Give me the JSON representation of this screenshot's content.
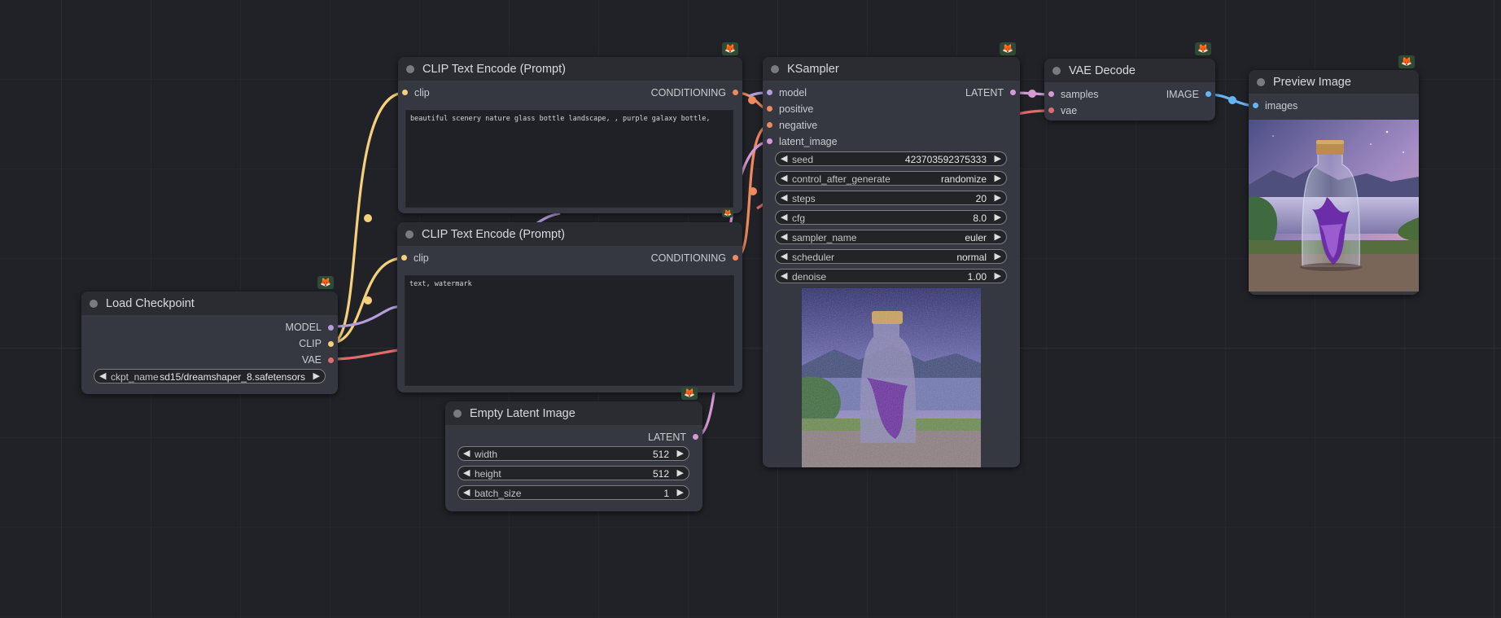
{
  "colors": {
    "model": "#b39ddb",
    "clip": "#f6d07a",
    "vae": "#e06c6c",
    "conditioning": "#f08a5d",
    "latent": "#d59ad6",
    "image": "#64b5f6"
  },
  "badge_icon": "fox-icon",
  "badge_glyph": "🦊",
  "nodes": {
    "load_checkpoint": {
      "title": "Load Checkpoint",
      "outputs": [
        "MODEL",
        "CLIP",
        "VAE"
      ],
      "ckpt_label": "ckpt_name",
      "ckpt_value": "sd15/dreamshaper_8.safetensors"
    },
    "clip_pos": {
      "title": "CLIP Text Encode (Prompt)",
      "input": "clip",
      "output": "CONDITIONING",
      "text": "beautiful scenery nature glass bottle landscape, , purple galaxy bottle,"
    },
    "clip_neg": {
      "title": "CLIP Text Encode (Prompt)",
      "input": "clip",
      "output": "CONDITIONING",
      "text": "text, watermark"
    },
    "empty_latent": {
      "title": "Empty Latent Image",
      "output": "LATENT",
      "widgets": [
        {
          "name": "width",
          "value": "512"
        },
        {
          "name": "height",
          "value": "512"
        },
        {
          "name": "batch_size",
          "value": "1"
        }
      ]
    },
    "ksampler": {
      "title": "KSampler",
      "inputs": [
        "model",
        "positive",
        "negative",
        "latent_image"
      ],
      "output": "LATENT",
      "widgets": [
        {
          "name": "seed",
          "value": "423703592375333"
        },
        {
          "name": "control_after_generate",
          "value": "randomize"
        },
        {
          "name": "steps",
          "value": "20"
        },
        {
          "name": "cfg",
          "value": "8.0"
        },
        {
          "name": "sampler_name",
          "value": "euler"
        },
        {
          "name": "scheduler",
          "value": "normal"
        },
        {
          "name": "denoise",
          "value": "1.00"
        }
      ]
    },
    "vae_decode": {
      "title": "VAE Decode",
      "inputs": [
        "samples",
        "vae"
      ],
      "output": "IMAGE"
    },
    "preview": {
      "title": "Preview Image",
      "input": "images"
    }
  },
  "arrows": {
    "left": "◀",
    "right": "▶"
  }
}
